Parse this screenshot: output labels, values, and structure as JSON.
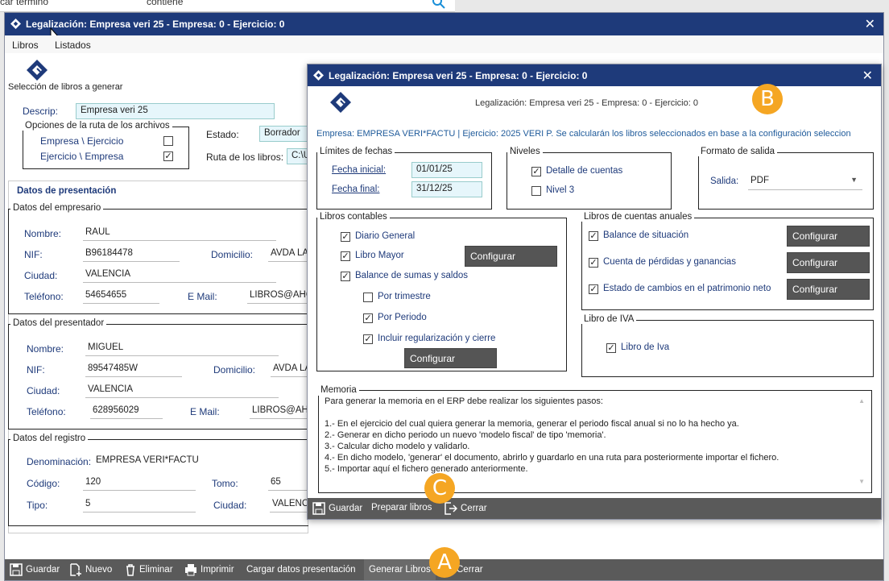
{
  "background": {
    "search_fragment": "car término",
    "search_op": "contiene"
  },
  "main": {
    "title": "Legalización: Empresa veri 25 - Empresa: 0 - Ejercicio: 0",
    "close": "✕",
    "menu": [
      "Libros",
      "Listados"
    ],
    "section_heading": "Selección de libros a generar",
    "descrip_label": "Descrip:",
    "descrip_value": "Empresa veri 25",
    "opciones_ruta": {
      "title": "Opciones de la ruta de los archivos",
      "opt1": "Empresa \\ Ejercicio",
      "opt1_checked": false,
      "opt2": "Ejercicio \\ Empresa",
      "opt2_checked": true
    },
    "estado_label": "Estado:",
    "estado_value": "Borrador",
    "ruta_label": "Ruta de los libros:",
    "ruta_value": "C:\\U",
    "datos_presentacion": "Datos de presentación",
    "empresario": {
      "title": "Datos del empresario",
      "nombre_label": "Nombre:",
      "nombre": "RAUL",
      "nif_label": "NIF:",
      "nif": "B96184478",
      "domicilio_label": "Domicilio:",
      "domicilio": "AVDA LA",
      "ciudad_label": "Ciudad:",
      "ciudad": "VALENCIA",
      "telefono_label": "Teléfono:",
      "telefono": "54654655",
      "email_label": "E Mail:",
      "email": "LIBROS@AHO"
    },
    "presentador": {
      "title": "Datos del presentador",
      "nombre_label": "Nombre:",
      "nombre": "MIGUEL",
      "nif_label": "NIF:",
      "nif": "89547485W",
      "domicilio_label": "Domicilio:",
      "domicilio": "AVDA LA",
      "ciudad_label": "Ciudad:",
      "ciudad": "VALENCIA",
      "telefono_label": "Teléfono:",
      "telefono": "628956029",
      "email_label": "E Mail:",
      "email": "LIBROS@AHO"
    },
    "registro": {
      "title": "Datos del registro",
      "denominacion_label": "Denominación:",
      "denominacion": "EMPRESA VERI*FACTU",
      "codigo_label": "Código:",
      "codigo": "120",
      "tomo_label": "Tomo:",
      "tomo": "65",
      "tipo_label": "Tipo:",
      "tipo": "5",
      "ciudad_label": "Ciudad:",
      "ciudad": "VALENC"
    },
    "toolbar": {
      "guardar": "Guardar",
      "nuevo": "Nuevo",
      "eliminar": "Eliminar",
      "imprimir": "Imprimir",
      "cargar": "Cargar datos presentación",
      "generar": "Generar Libros",
      "cerrar": "Cerrar"
    }
  },
  "dialog": {
    "title": "Legalización: Empresa veri 25 - Empresa: 0 - Ejercicio: 0",
    "close": "✕",
    "header_text": "Legalización: Empresa veri 25 - Empresa: 0 - Ejercicio: 0",
    "info": "Empresa: EMPRESA VERI*FACTU | Ejercicio: 2025 VERI P. Se calcularán los libros seleccionados en base a la configuración seleccion",
    "limites": {
      "title": "Límites de fechas",
      "inicial_label": "Fecha inicial:",
      "inicial": "01/01/25",
      "final_label": "Fecha final:",
      "final": "31/12/25"
    },
    "niveles": {
      "title": "Niveles",
      "detalle": "Detalle de cuentas",
      "detalle_checked": true,
      "nivel3": "Nivel 3",
      "nivel3_checked": false
    },
    "formato": {
      "title": "Formato de salida",
      "salida_label": "Salida:",
      "salida": "PDF"
    },
    "contables": {
      "title": "Libros contables",
      "diario": "Diario General",
      "diario_checked": true,
      "mayor": "Libro Mayor",
      "mayor_checked": true,
      "balance": "Balance de sumas y saldos",
      "balance_checked": true,
      "trimestre": "Por trimestre",
      "trimestre_checked": false,
      "periodo": "Por Periodo",
      "periodo_checked": true,
      "regularizacion": "Incluir regularización y cierre",
      "regularizacion_checked": true,
      "configurar": "Configurar"
    },
    "anuales": {
      "title": "Libros de cuentas anuales",
      "situacion": "Balance de situación",
      "perdidas": "Cuenta de pérdidas y ganancias",
      "patrimonio": "Estado de cambios en el patrimonio neto",
      "configurar": "Configurar"
    },
    "iva": {
      "title": "Libro de IVA",
      "libro": "Libro de Iva",
      "checked": true
    },
    "memoria": {
      "title": "Memoria",
      "lines": [
        "Para generar la memoria en el ERP debe realizar los siguientes pasos:",
        "",
        "1.- En el ejercicio del cual quiera generar la memoria, generar el periodo fiscal anual si no lo ha hecho ya.",
        "2.- Generar en dicho periodo un nuevo 'modelo fiscal' de tipo 'memoria'.",
        "3.- Calcular dicho modelo y validarlo.",
        "4.- En dicho modelo, 'generar' el documento, abrirlo y guardarlo en una ruta para posteriormente importar el fichero.",
        "5.- Importar aquí el fichero generado anteriormente."
      ]
    },
    "toolbar": {
      "guardar": "Guardar",
      "preparar": "Preparar libros",
      "cerrar": "Cerrar"
    }
  },
  "annotations": {
    "a": "A",
    "b": "B",
    "c": "C"
  },
  "colors": {
    "titlebar": "#1e3a7a",
    "badge": "#f5a623",
    "toolbar": "#5a5a5a",
    "button": "#555555"
  }
}
